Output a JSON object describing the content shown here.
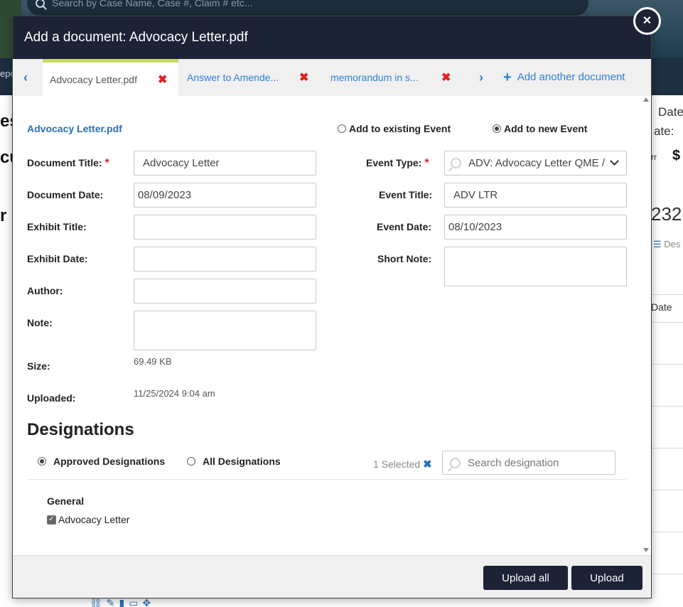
{
  "background": {
    "search_placeholder": "Search by Case Name, Case #, Claim # etc...",
    "nav_fragment": "epo",
    "frag_es": "es",
    "frag_cu": "cu",
    "frag_r": "r",
    "right_date_1": "Date",
    "right_date_2": "ate:",
    "right_rr": "rr",
    "right_dollar": "$",
    "right_232": "232",
    "right_des": "Des",
    "right_date_col": "Date"
  },
  "modal": {
    "title": "Add a document: Advocacy Letter.pdf",
    "close_label": "×",
    "tabs": [
      {
        "label": "Advocacy Letter.pdf",
        "active": true
      },
      {
        "label": "Answer to Amende...",
        "active": false
      },
      {
        "label": "memorandum in s...",
        "active": false
      }
    ],
    "tab_remove_glyph": "✖",
    "prev_glyph": "‹",
    "next_glyph": "›",
    "add_another_label": "Add another document",
    "file_name": "Advocacy Letter.pdf",
    "event_options": {
      "existing": "Add to existing Event",
      "new": "Add to new Event",
      "selected": "new"
    },
    "fields": {
      "document_title": {
        "label": "Document Title:",
        "value": "Advocacy Letter"
      },
      "document_date": {
        "label": "Document Date:",
        "value": "08/09/2023"
      },
      "exhibit_title": {
        "label": "Exhibit Title:",
        "value": ""
      },
      "exhibit_date": {
        "label": "Exhibit Date:",
        "value": ""
      },
      "author": {
        "label": "Author:",
        "value": ""
      },
      "note": {
        "label": "Note:",
        "value": ""
      },
      "size": {
        "label": "Size:",
        "value": "69.49 KB"
      },
      "uploaded": {
        "label": "Uploaded:",
        "value": "11/25/2024 9:04 am"
      },
      "event_type": {
        "label": "Event Type:",
        "value": "ADV: Advocacy Letter QME / AME"
      },
      "event_title": {
        "label": "Event Title:",
        "value": "ADV LTR"
      },
      "event_date": {
        "label": "Event Date:",
        "value": "08/10/2023"
      },
      "short_note": {
        "label": "Short Note:",
        "value": ""
      }
    },
    "required_marker": "*",
    "designations": {
      "title": "Designations",
      "approved_label": "Approved Designations",
      "all_label": "All Designations",
      "selected_filter": "approved",
      "selected_count": "1 Selected",
      "clear_glyph": "✖",
      "search_placeholder": "Search designation",
      "group_title": "General",
      "items": [
        {
          "label": "Advocacy Letter",
          "checked": true
        }
      ]
    },
    "footer": {
      "upload_all_label": "Upload all",
      "upload_label": "Upload"
    }
  },
  "colors": {
    "header_bg": "#1c2335",
    "accent": "#2f7fd6",
    "link": "#2a6fb5",
    "remove": "#e02020",
    "active_tab_bar": "#c6db6a"
  }
}
